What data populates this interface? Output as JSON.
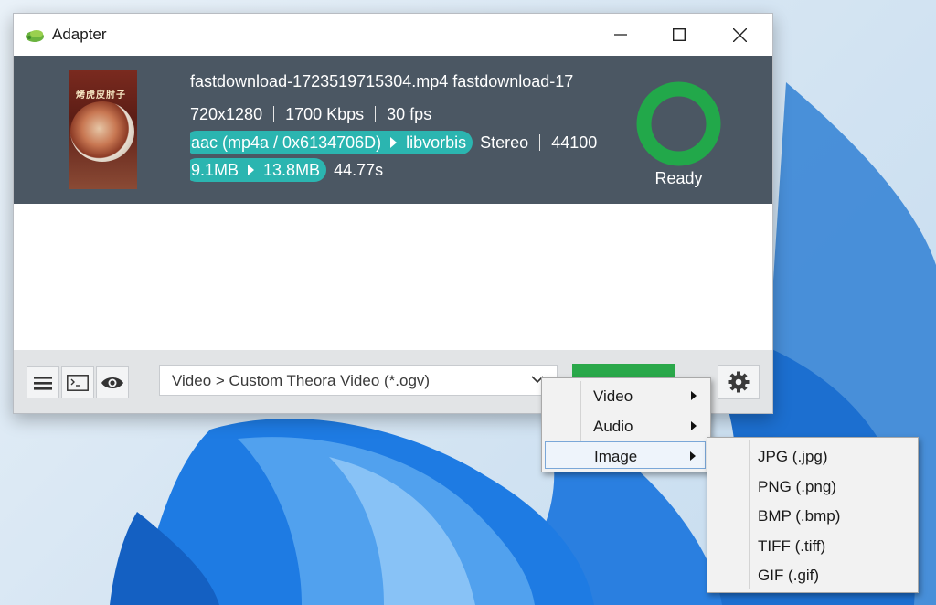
{
  "window": {
    "title": "Adapter"
  },
  "file": {
    "names_line": "fastdownload-1723519715304.mp4   fastdownload-17",
    "resolution": "720x1280",
    "bitrate": "1700 Kbps",
    "fps": "30 fps",
    "audio_codec_from": "aac (mp4a / 0x6134706D)",
    "audio_codec_to": "libvorbis",
    "channels": "Stereo",
    "sample_rate": "44100",
    "size_from": "9.1MB",
    "size_to": "13.8MB",
    "duration": "44.77s",
    "thumb_text": "烤虎皮肘子",
    "status": "Ready"
  },
  "toolbar": {
    "format_value": "Video > Custom Theora Video (*.ogv)"
  },
  "context_menu": {
    "items": [
      {
        "label": "Video"
      },
      {
        "label": "Audio"
      },
      {
        "label": "Image"
      }
    ],
    "image_submenu": [
      {
        "label": "JPG (.jpg)"
      },
      {
        "label": "PNG (.png)"
      },
      {
        "label": "BMP (.bmp)"
      },
      {
        "label": "TIFF (.tiff)"
      },
      {
        "label": "GIF (.gif)"
      }
    ]
  },
  "colors": {
    "header_bg": "#4b5763",
    "pill": "#2bb5b0",
    "ready_ring": "#22a84a",
    "convert_button": "#2aa84a"
  }
}
